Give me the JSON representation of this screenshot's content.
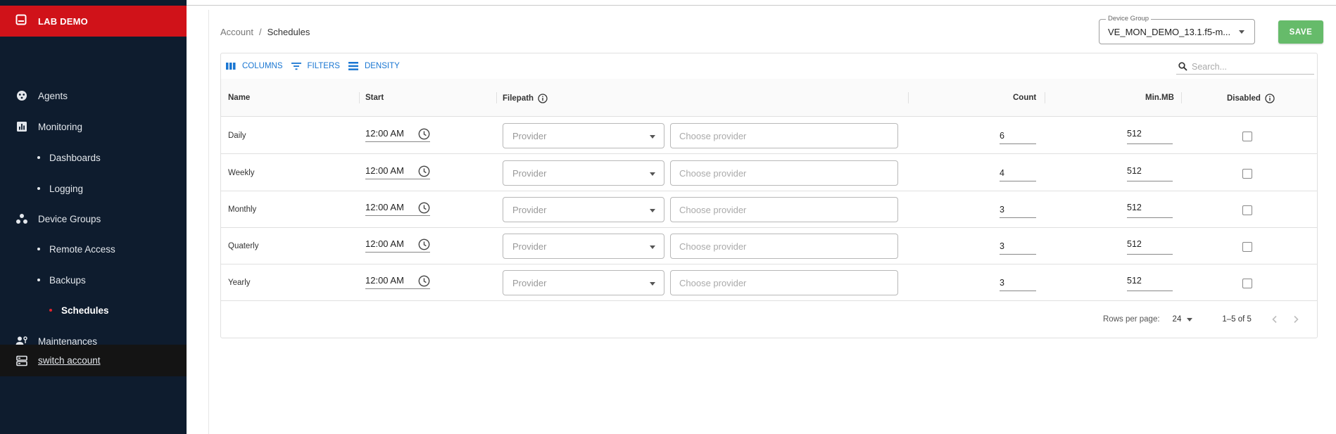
{
  "brand": {
    "name": "LAB DEMO"
  },
  "sidebar": {
    "items": [
      {
        "label": "Agents",
        "icon": "agents-icon",
        "level": 0
      },
      {
        "label": "Monitoring",
        "icon": "monitoring-icon",
        "level": 0
      },
      {
        "label": "Dashboards",
        "level": 1
      },
      {
        "label": "Logging",
        "level": 1
      },
      {
        "label": "Device Groups",
        "icon": "device-groups-icon",
        "level": 0
      },
      {
        "label": "Remote Access",
        "level": 1
      },
      {
        "label": "Backups",
        "level": 1
      },
      {
        "label": "Schedules",
        "level": 2,
        "active": true
      },
      {
        "label": "Maintenances",
        "icon": "maintenances-icon",
        "level": 0
      }
    ],
    "switch_account": "switch account"
  },
  "breadcrumb": {
    "parent": "Account",
    "separator": "/",
    "current": "Schedules"
  },
  "device_group": {
    "label": "Device Group",
    "value": "VE_MON_DEMO_13.1.f5-m..."
  },
  "save_label": "SAVE",
  "toolbar": {
    "columns": "COLUMNS",
    "filters": "FILTERS",
    "density": "DENSITY",
    "search_placeholder": "Search..."
  },
  "columns": {
    "name": "Name",
    "start": "Start",
    "filepath": "Filepath",
    "count": "Count",
    "minmb": "Min.MB",
    "disabled": "Disabled"
  },
  "rows": [
    {
      "name": "Daily",
      "start": "12:00 AM",
      "provider": "Provider",
      "choose": "Choose provider",
      "count": "6",
      "minmb": "512",
      "disabled": false
    },
    {
      "name": "Weekly",
      "start": "12:00 AM",
      "provider": "Provider",
      "choose": "Choose provider",
      "count": "4",
      "minmb": "512",
      "disabled": false
    },
    {
      "name": "Monthly",
      "start": "12:00 AM",
      "provider": "Provider",
      "choose": "Choose provider",
      "count": "3",
      "minmb": "512",
      "disabled": false
    },
    {
      "name": "Quaterly",
      "start": "12:00 AM",
      "provider": "Provider",
      "choose": "Choose provider",
      "count": "3",
      "minmb": "512",
      "disabled": false
    },
    {
      "name": "Yearly",
      "start": "12:00 AM",
      "provider": "Provider",
      "choose": "Choose provider",
      "count": "3",
      "minmb": "512",
      "disabled": false
    }
  ],
  "pagination": {
    "rows_per_page_label": "Rows per page:",
    "rows_per_page": "24",
    "range": "1–5 of 5"
  },
  "colors": {
    "brand_red": "#d01219",
    "sidebar_bg": "#0e1c2e",
    "accent_blue": "#1976d2",
    "save_green": "#66bb6a"
  }
}
